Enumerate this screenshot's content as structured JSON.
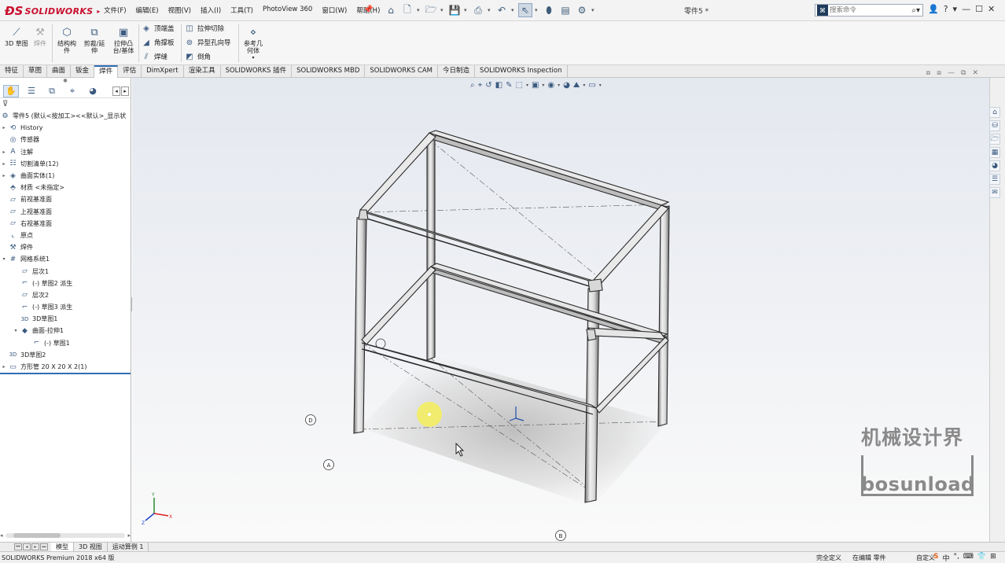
{
  "app": {
    "logo_text": "SOLIDWORKS",
    "document_title": "零件5 *",
    "menus": [
      "文件(F)",
      "编辑(E)",
      "视图(V)",
      "插入(I)",
      "工具(T)",
      "PhotoView 360",
      "窗口(W)",
      "帮助(H)"
    ],
    "search_placeholder": "搜索命令"
  },
  "ribbon": {
    "big_buttons": [
      {
        "label": "3D 草图",
        "icon": "3d-sketch-icon",
        "enabled": true
      },
      {
        "label": "焊件",
        "icon": "weldment-icon",
        "enabled": false
      },
      {
        "label": "结构构件",
        "icon": "structural-member-icon",
        "enabled": true
      },
      {
        "label": "剪裁/延伸",
        "icon": "trim-extend-icon",
        "enabled": true
      },
      {
        "label": "拉伸凸台/基体",
        "icon": "extrude-boss-icon",
        "enabled": true
      }
    ],
    "small_col1": [
      "顶端盖",
      "角撑板",
      "焊缝"
    ],
    "small_col2": [
      "拉伸切除",
      "异型孔向导",
      "倒角"
    ],
    "ref_geometry": "参考几何体"
  },
  "tabs": [
    "特征",
    "草图",
    "曲面",
    "钣金",
    "焊件",
    "评估",
    "DimXpert",
    "渲染工具",
    "SOLIDWORKS 插件",
    "SOLIDWORKS MBD",
    "SOLIDWORKS CAM",
    "今日制造",
    "SOLIDWORKS Inspection"
  ],
  "active_tab": "焊件",
  "feature_tree": {
    "root": "零件5 (默认<按加工><<默认>_显示状",
    "items": [
      {
        "label": "History",
        "icon": "history-icon",
        "expander": "▸",
        "indent": 0
      },
      {
        "label": "传感器",
        "icon": "sensor-icon",
        "expander": "",
        "indent": 0
      },
      {
        "label": "注解",
        "icon": "annotation-icon",
        "expander": "▸",
        "indent": 0
      },
      {
        "label": "切割清单(12)",
        "icon": "cut-list-icon",
        "expander": "▸",
        "indent": 0
      },
      {
        "label": "曲面实体(1)",
        "icon": "surface-body-icon",
        "expander": "▸",
        "indent": 0
      },
      {
        "label": "材质 <未指定>",
        "icon": "material-icon",
        "expander": "",
        "indent": 0
      },
      {
        "label": "前视基准面",
        "icon": "plane-icon",
        "expander": "",
        "indent": 0
      },
      {
        "label": "上视基准面",
        "icon": "plane-icon",
        "expander": "",
        "indent": 0
      },
      {
        "label": "右视基准面",
        "icon": "plane-icon",
        "expander": "",
        "indent": 0
      },
      {
        "label": "原点",
        "icon": "origin-icon",
        "expander": "",
        "indent": 0
      },
      {
        "label": "焊件",
        "icon": "weldment-icon",
        "expander": "",
        "indent": 0
      },
      {
        "label": "网格系统1",
        "icon": "grid-system-icon",
        "expander": "▾",
        "indent": 0
      },
      {
        "label": "层次1",
        "icon": "plane-icon",
        "expander": "",
        "indent": 1
      },
      {
        "label": "(-) 草图2 派生",
        "icon": "sketch-icon",
        "expander": "",
        "indent": 1
      },
      {
        "label": "层次2",
        "icon": "plane-icon",
        "expander": "",
        "indent": 1
      },
      {
        "label": "(-) 草图3 派生",
        "icon": "sketch-icon",
        "expander": "",
        "indent": 1
      },
      {
        "label": "3D草图1",
        "icon": "3d-sketch-icon",
        "expander": "",
        "indent": 1
      },
      {
        "label": "曲面-拉伸1",
        "icon": "surface-extrude-icon",
        "expander": "▾",
        "indent": 1
      },
      {
        "label": "(-) 草图1",
        "icon": "sketch-icon",
        "expander": "",
        "indent": 2
      },
      {
        "label": "3D草图2",
        "icon": "3d-sketch-icon",
        "expander": "",
        "indent": 0
      },
      {
        "label": "方形管 20 X 20 X 2(1)",
        "icon": "structural-member-icon",
        "expander": "▸",
        "indent": 0
      }
    ]
  },
  "viewport": {
    "grid_labels": [
      "D",
      "A",
      "B"
    ],
    "watermark_cn": "机械设计界",
    "watermark_en": "bosunload"
  },
  "bottom_tabs": [
    "模型",
    "3D 视图",
    "运动算例 1"
  ],
  "status": {
    "product": "SOLIDWORKS Premium 2018 x64 版",
    "definition": "完全定义",
    "editing": "在编辑 零件",
    "custom": "自定义",
    "ime_items": [
      "中",
      "°,",
      "⌨",
      "👕",
      "⊞"
    ]
  },
  "colors": {
    "accent": "#2f6db5",
    "brand_red": "#c8102e",
    "highlight": "#f5ee5a"
  }
}
